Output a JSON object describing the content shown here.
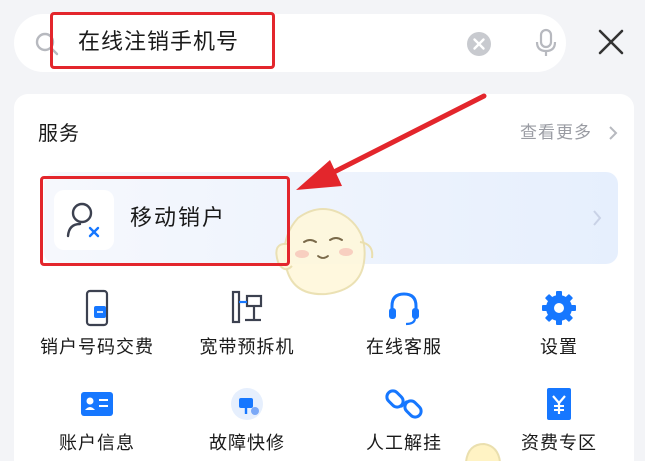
{
  "search": {
    "query": "在线注销手机号",
    "icons": {
      "search": "search-icon",
      "clear": "clear-icon",
      "mic": "microphone-icon",
      "close": "close-icon"
    }
  },
  "section": {
    "title": "服务",
    "more_label": "查看更多"
  },
  "featured_card": {
    "label": "移动销户",
    "icon": "user-remove-icon"
  },
  "grid": [
    {
      "label": "销户号码交费",
      "icon": "phone-payment-icon"
    },
    {
      "label": "宽带预拆机",
      "icon": "broadband-dismantle-icon"
    },
    {
      "label": "在线客服",
      "icon": "headset-icon"
    },
    {
      "label": "设置",
      "icon": "gear-icon"
    },
    {
      "label": "账户信息",
      "icon": "id-card-icon"
    },
    {
      "label": "故障快修",
      "icon": "repair-icon"
    },
    {
      "label": "人工解挂",
      "icon": "unlink-icon"
    },
    {
      "label": "资费专区",
      "icon": "yuan-tag-icon"
    }
  ],
  "colors": {
    "highlight": "#e3262c",
    "accent_blue": "#1677ff",
    "muted_text": "#9a9ca3",
    "card_gradient_end": "#e6effd"
  }
}
